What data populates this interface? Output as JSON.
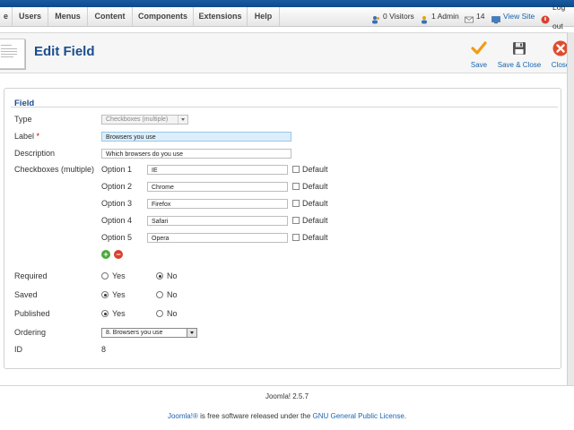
{
  "menu": {
    "items": [
      {
        "label": "e"
      },
      {
        "label": "Users"
      },
      {
        "label": "Menus"
      },
      {
        "label": "Content"
      },
      {
        "label": "Components"
      },
      {
        "label": "Extensions"
      },
      {
        "label": "Help"
      }
    ]
  },
  "status": {
    "visitors": "0 Visitors",
    "admins": "1 Admin",
    "messages": "14",
    "view_site": "View Site",
    "logout": "Log out"
  },
  "toolbar": {
    "title": "Edit Field",
    "save": "Save",
    "save_close": "Save & Close",
    "close": "Close"
  },
  "form": {
    "legend": "Field",
    "type_label": "Type",
    "type_value": "Checkboxes (multiple)",
    "label_label": "Label",
    "label_required": "*",
    "label_value": "Browsers you use",
    "description_label": "Description",
    "description_value": "Which browsers do you use",
    "options_label": "Checkboxes (multiple)",
    "options": [
      {
        "label": "Option 1",
        "value": "IE",
        "default_label": "Default"
      },
      {
        "label": "Option 2",
        "value": "Chrome",
        "default_label": "Default"
      },
      {
        "label": "Option 3",
        "value": "Firefox",
        "default_label": "Default"
      },
      {
        "label": "Option 4",
        "value": "Safari",
        "default_label": "Default"
      },
      {
        "label": "Option 5",
        "value": "Opera",
        "default_label": "Default"
      }
    ],
    "add_symbol": "+",
    "remove_symbol": "−",
    "required_label": "Required",
    "saved_label": "Saved",
    "published_label": "Published",
    "yes": "Yes",
    "no": "No",
    "ordering_label": "Ordering",
    "ordering_value": "8. Browsers you use",
    "id_label": "ID",
    "id_value": "8"
  },
  "footer": {
    "version": "Joomla! 2.5.7",
    "joomla_link": "Joomla!®",
    "license_text": " is free software released under the ",
    "license_link": "GNU General Public License",
    "license_end": "."
  },
  "colors": {
    "accent": "#1a4d8f",
    "link": "#1a64b0",
    "save_icon": "#f39c12",
    "close_icon": "#e04b2c",
    "add_button": "#4aa83a",
    "remove_button": "#d9412e"
  },
  "icons": {
    "visitors": "users-icon",
    "admins": "admin-icon",
    "messages": "mail-icon",
    "view_site": "monitor-icon",
    "logout": "logout-icon",
    "save": "checkmark-icon",
    "save_close": "floppy-disk-icon",
    "close": "close-circle-icon"
  }
}
